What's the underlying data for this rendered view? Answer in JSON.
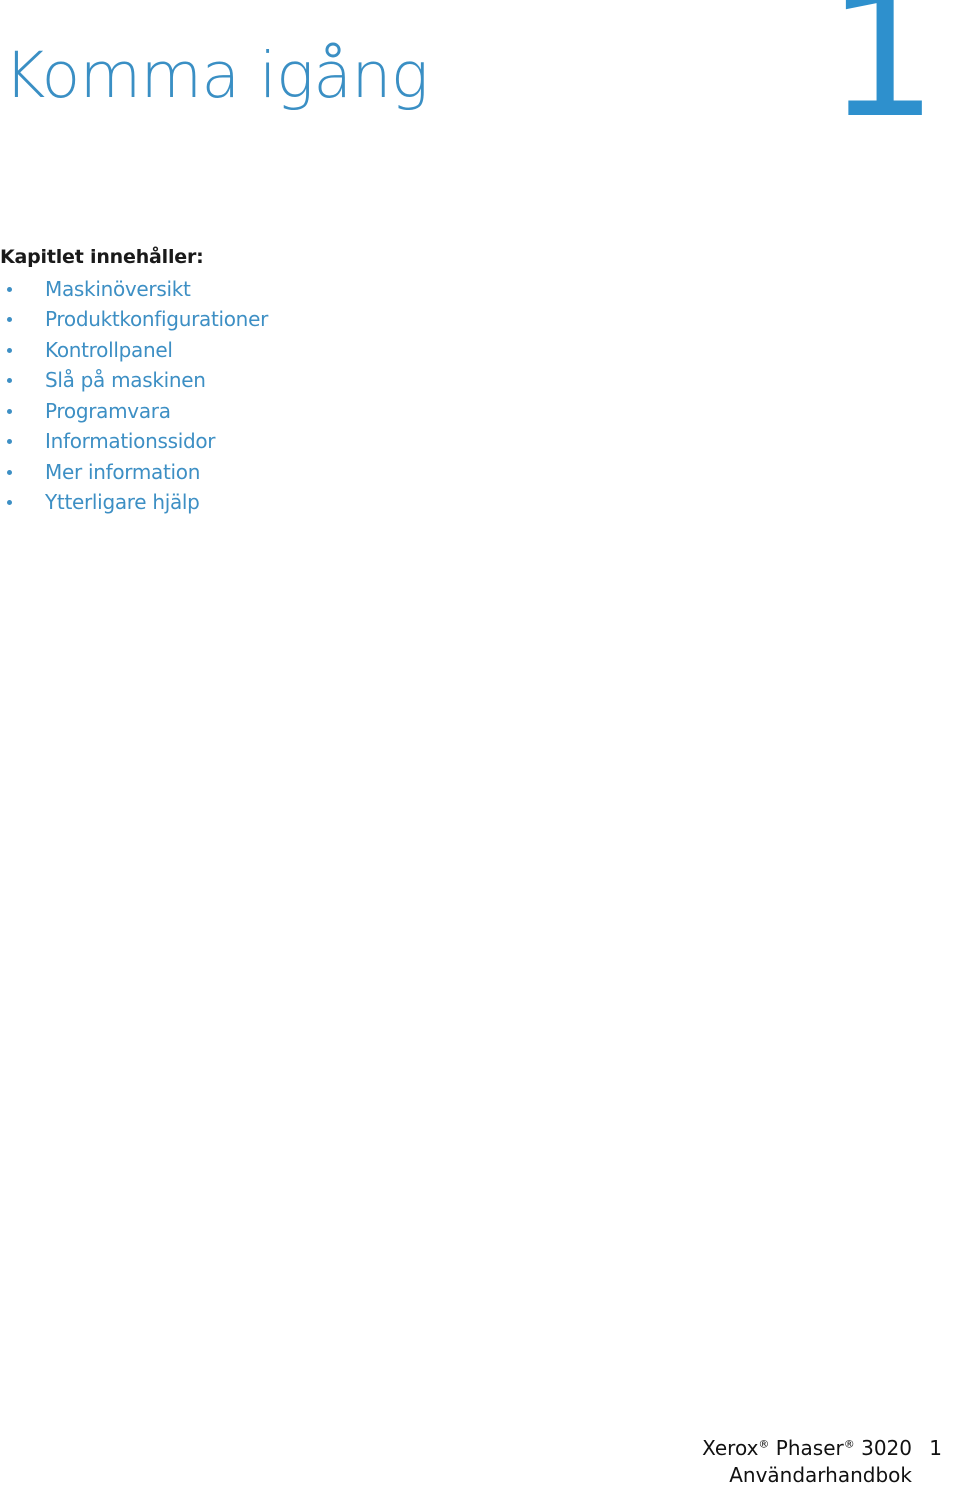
{
  "header": {
    "chapter_title": "Komma igång",
    "chapter_number": "1",
    "title_color": "#3a8fc4",
    "number_color": "#2e90cd"
  },
  "contents": {
    "heading": "Kapitlet innehåller:",
    "heading_color": "#1a1a1a",
    "item_color": "#3d8fc4",
    "items": [
      {
        "label": "Maskinöversikt"
      },
      {
        "label": "Produktkonfigurationer"
      },
      {
        "label": "Kontrollpanel"
      },
      {
        "label": "Slå på maskinen"
      },
      {
        "label": "Programvara"
      },
      {
        "label": "Informationssidor"
      },
      {
        "label": "Mer information"
      },
      {
        "label": "Ytterligare hjälp"
      }
    ]
  },
  "footer": {
    "brand": "Xerox",
    "brand_mark": "®",
    "product_line": "Phaser",
    "product_mark": "®",
    "model": "3020",
    "doc_title": "Användarhandbok",
    "page_number": "1"
  }
}
